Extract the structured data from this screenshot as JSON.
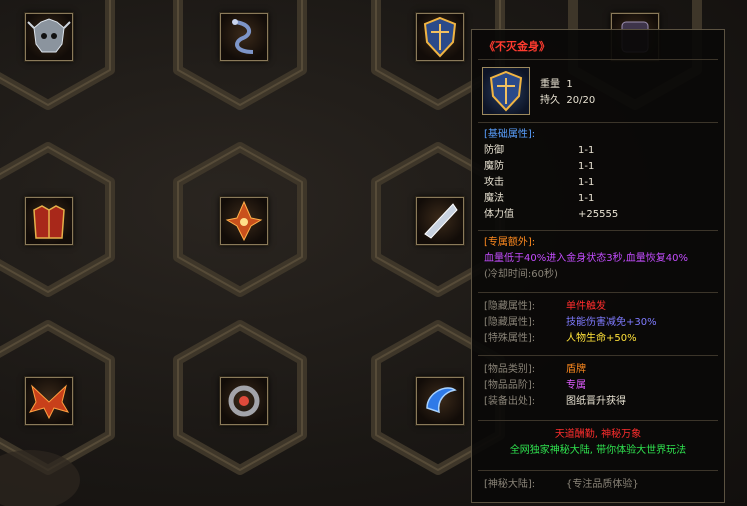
{
  "item": {
    "title": "《不灭金身》",
    "weight_label": "重量",
    "weight_value": "1",
    "durability_label": "持久",
    "durability_value": "20/20",
    "base_header": "[基础属性]:",
    "base_stats": [
      {
        "name": "防御",
        "value": "1-1"
      },
      {
        "name": "魔防",
        "value": "1-1"
      },
      {
        "name": "攻击",
        "value": "1-1"
      },
      {
        "name": "魔法",
        "value": "1-1"
      },
      {
        "name": "体力值",
        "value": "+25555"
      }
    ],
    "exclusive_header": "[专属额外]:",
    "exclusive_desc": "血量低于40%进入金身状态3秒,血量恢复40%",
    "cooldown": "(冷却时间:60秒)",
    "hidden_rows": [
      {
        "label": "[隐藏属性]:",
        "value": "单件触发"
      },
      {
        "label": "[隐藏属性]:",
        "value": "技能伤害减免+30%"
      },
      {
        "label": "[特殊属性]:",
        "value": "人物生命+50%"
      }
    ],
    "info_rows": [
      {
        "label": "[物品类别]:",
        "value": "盾牌"
      },
      {
        "label": "[物品品阶]:",
        "value": "专属"
      },
      {
        "label": "[装备出处]:",
        "value": "图纸晋升获得"
      }
    ],
    "flavor_line1": "天道酬勤, 神秘万象",
    "flavor_line2": "全网独家神秘大陆, 带你体验大世界玩法",
    "footer_label": "[神秘大陆]:",
    "footer_value": "{专注品质体验}"
  },
  "grid_items": [
    {
      "icon": "skull-helmet-icon",
      "color": "#9aa3ad"
    },
    {
      "icon": "serpent-necklace-icon",
      "color": "#6f86b5"
    },
    {
      "icon": "golden-shield-icon",
      "color": "#e0a43a"
    },
    {
      "icon": "dark-armor-icon",
      "color": "#5a4a66"
    },
    {
      "icon": "red-armor-icon",
      "color": "#c23a24"
    },
    {
      "icon": "flame-emblem-icon",
      "color": "#e0652a"
    },
    {
      "icon": "crystal-blade-icon",
      "color": "#b8c6d8"
    },
    {
      "icon": "phoenix-wings-icon",
      "color": "#d84a1e"
    },
    {
      "icon": "spiked-ring-icon",
      "color": "#9b9ba0"
    },
    {
      "icon": "blue-orb-icon",
      "color": "#3a8cff"
    }
  ]
}
